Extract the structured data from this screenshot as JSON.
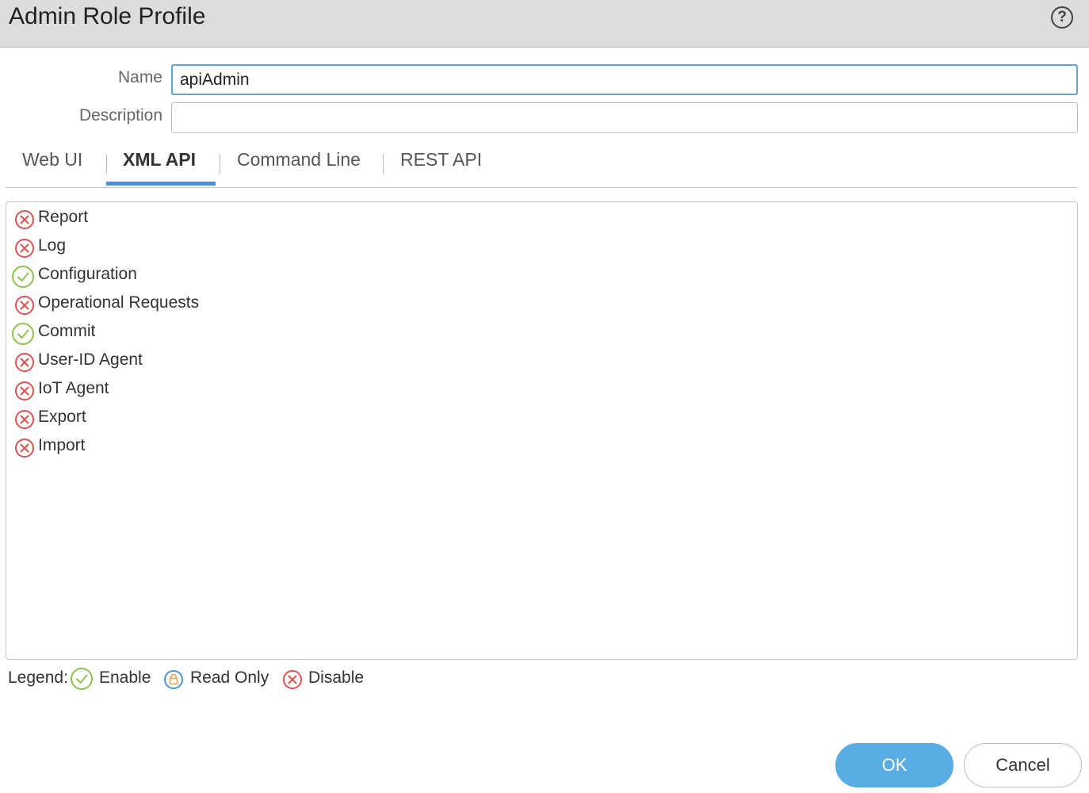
{
  "dialog": {
    "title": "Admin Role Profile",
    "help_label": "?"
  },
  "form": {
    "name_label": "Name",
    "name_value": "apiAdmin",
    "description_label": "Description",
    "description_value": ""
  },
  "tabs": [
    {
      "label": "Web UI",
      "active": false
    },
    {
      "label": "XML API",
      "active": true
    },
    {
      "label": "Command Line",
      "active": false
    },
    {
      "label": "REST API",
      "active": false
    }
  ],
  "permissions": [
    {
      "label": "Report",
      "state": "disable"
    },
    {
      "label": "Log",
      "state": "disable"
    },
    {
      "label": "Configuration",
      "state": "enable"
    },
    {
      "label": "Operational Requests",
      "state": "disable"
    },
    {
      "label": "Commit",
      "state": "enable"
    },
    {
      "label": "User-ID Agent",
      "state": "disable"
    },
    {
      "label": "IoT Agent",
      "state": "disable"
    },
    {
      "label": "Export",
      "state": "disable"
    },
    {
      "label": "Import",
      "state": "disable"
    }
  ],
  "legend": {
    "label": "Legend:",
    "enable": "Enable",
    "read_only": "Read Only",
    "disable": "Disable"
  },
  "buttons": {
    "ok": "OK",
    "cancel": "Cancel"
  },
  "colors": {
    "enable": "#8dc14f",
    "disable": "#d9534f",
    "read_only": "#4a93d5",
    "accent": "#5aace4"
  }
}
